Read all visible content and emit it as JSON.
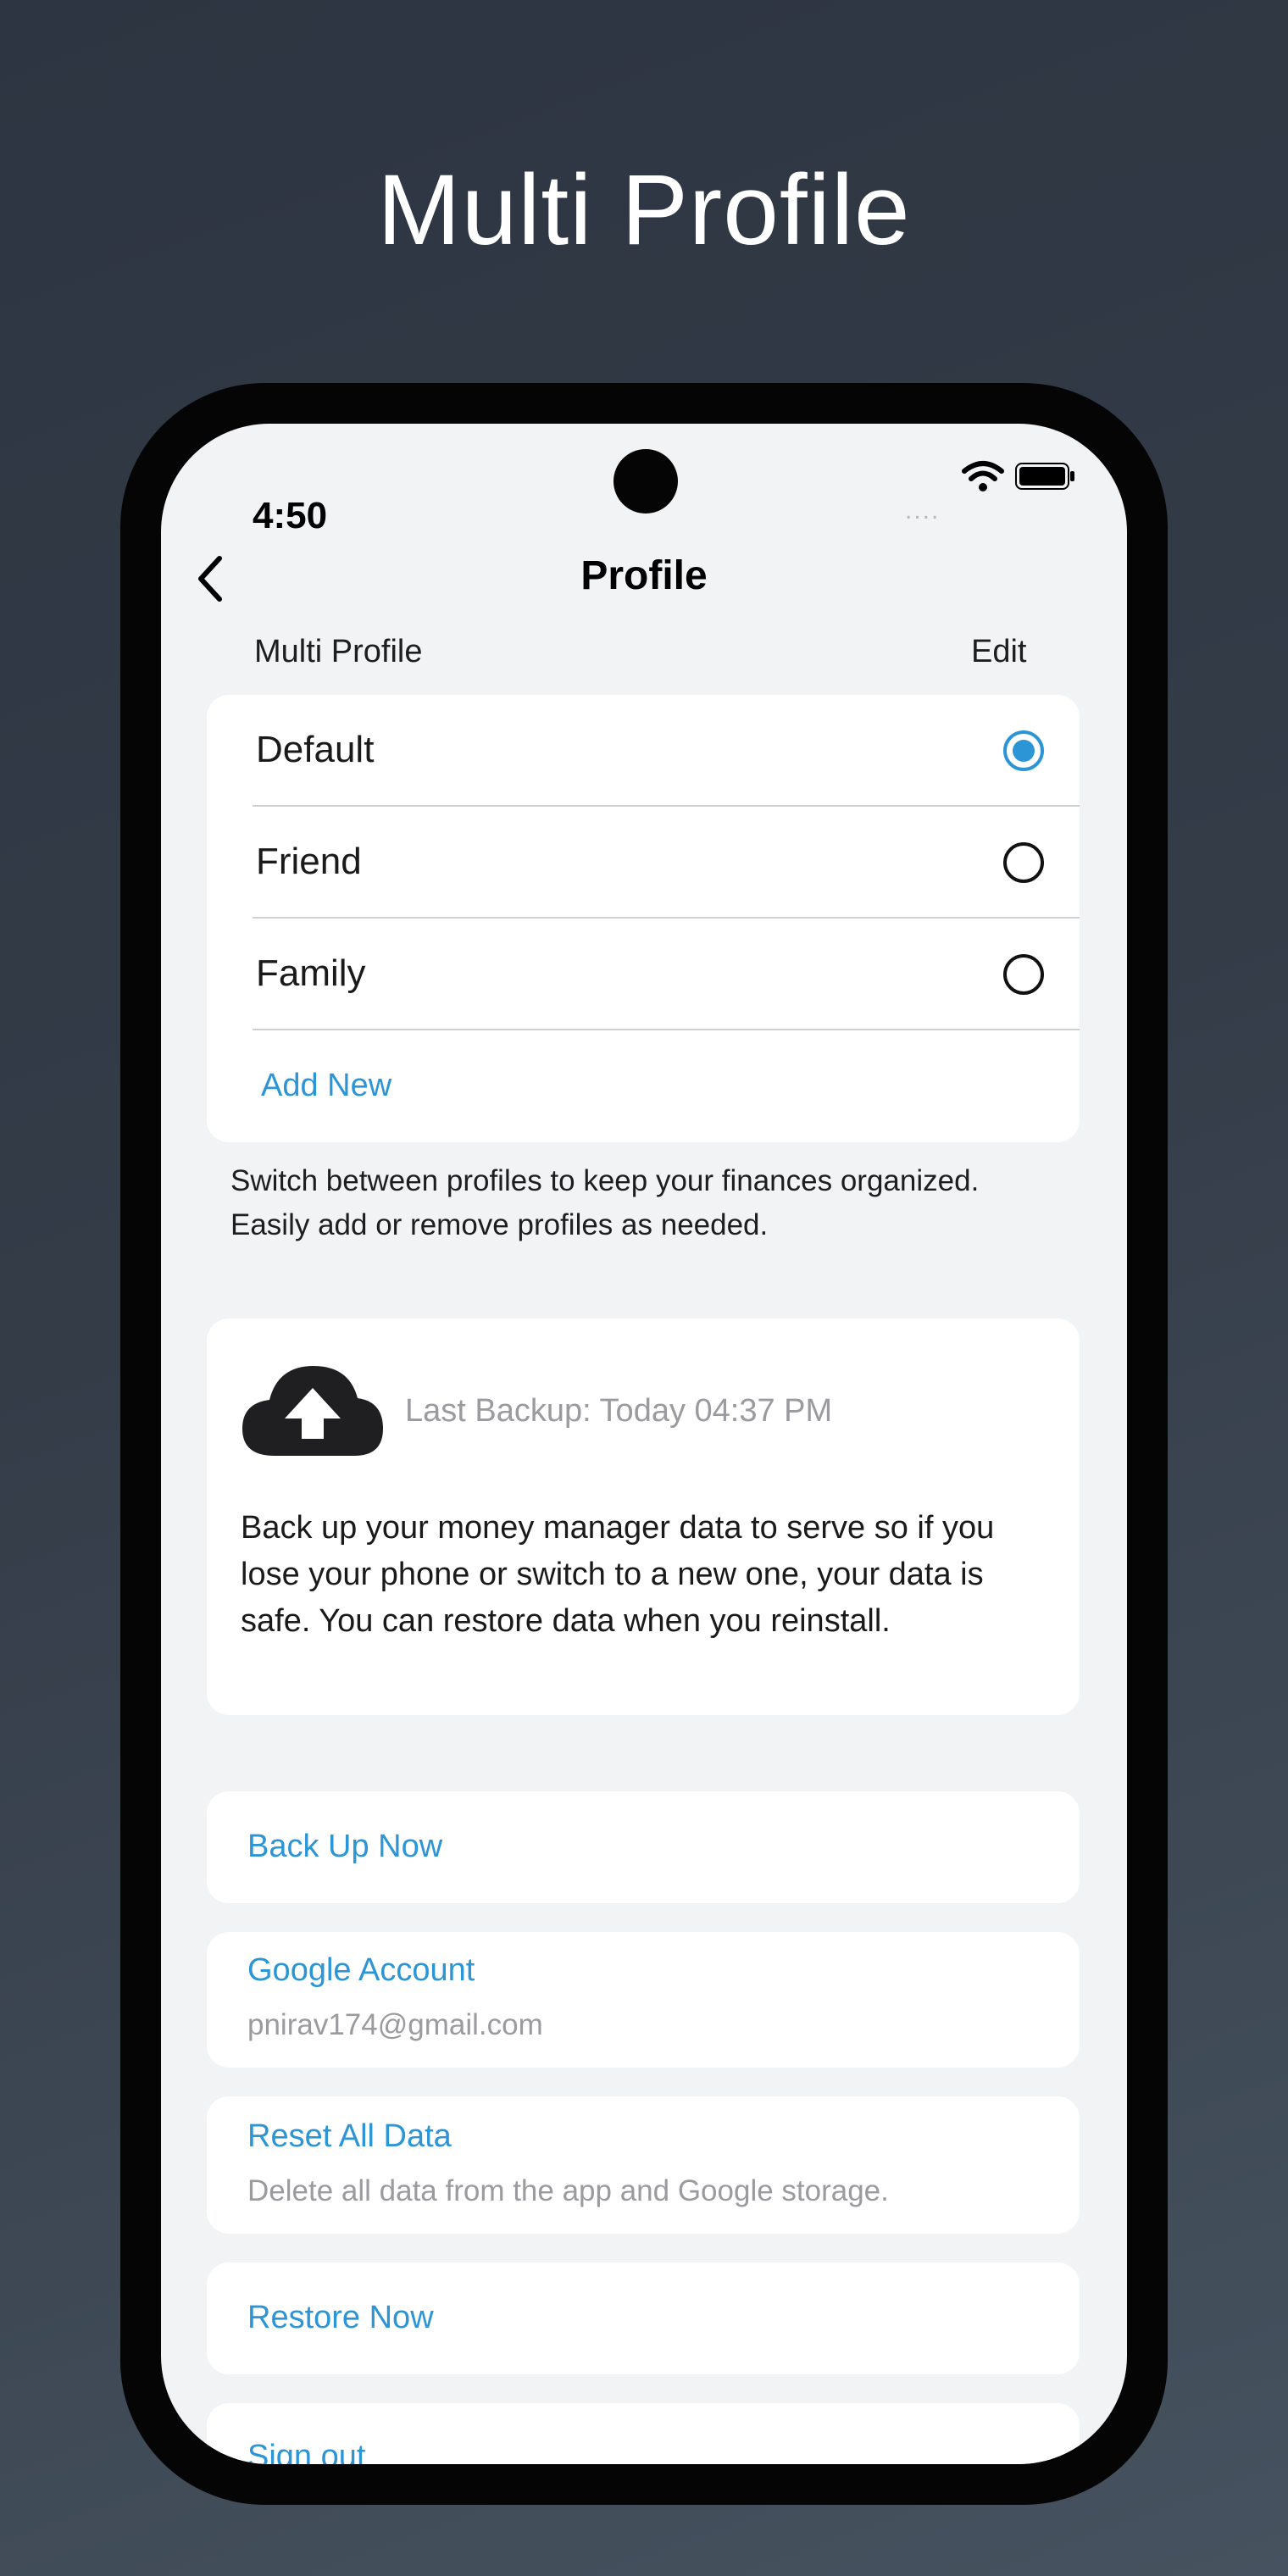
{
  "headline": "Multi Profile",
  "status_bar": {
    "time": "4:50",
    "signal": "....",
    "icons": [
      "wifi-icon",
      "battery-icon"
    ]
  },
  "nav": {
    "back_icon": "chevron-left-icon",
    "title": "Profile"
  },
  "profiles": {
    "section_label": "Multi Profile",
    "edit_label": "Edit",
    "items": [
      {
        "label": "Default",
        "selected": true
      },
      {
        "label": "Friend",
        "selected": false
      },
      {
        "label": "Family",
        "selected": false
      }
    ],
    "add_new_label": "Add New",
    "description": "Switch between profiles to keep your finances organized. Easily add or remove profiles as needed."
  },
  "backup": {
    "icon": "cloud-upload-icon",
    "last_backup": "Last Backup: Today 04:37 PM",
    "description": "Back up your money manager data to serve so if you lose your phone or switch to a new one, your data is safe. You can restore data when you reinstall."
  },
  "actions": {
    "back_up_now": "Back Up Now",
    "google_account": {
      "title": "Google Account",
      "email": "pnirav174@gmail.com"
    },
    "reset_all_data": {
      "title": "Reset All Data",
      "subtitle": "Delete all data from the app and Google storage."
    },
    "restore_now": "Restore Now",
    "sign_out": "Sign out"
  },
  "colors": {
    "accent": "#2b95d6",
    "screen_background": "#f2f3f5",
    "card_background": "#ffffff",
    "secondary_text": "#9a9a9f"
  }
}
